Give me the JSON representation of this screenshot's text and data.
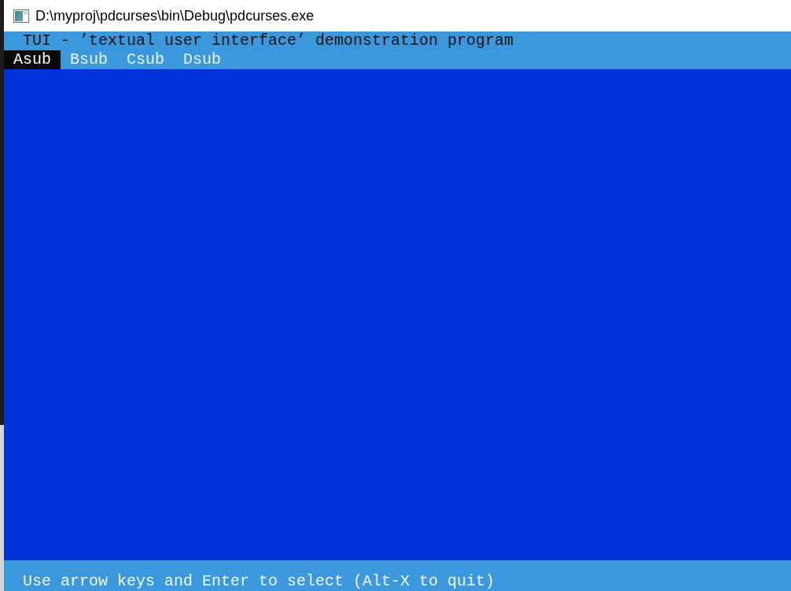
{
  "window": {
    "title": "D:\\myproj\\pdcurses\\bin\\Debug\\pdcurses.exe"
  },
  "console": {
    "title": "TUI - ’textual user interface’ demonstration program",
    "menu": [
      {
        "label": "Asub",
        "selected": true
      },
      {
        "label": "Bsub",
        "selected": false
      },
      {
        "label": "Csub",
        "selected": false
      },
      {
        "label": "Dsub",
        "selected": false
      }
    ],
    "status": "Use arrow keys and Enter to select (Alt-X to quit)"
  }
}
